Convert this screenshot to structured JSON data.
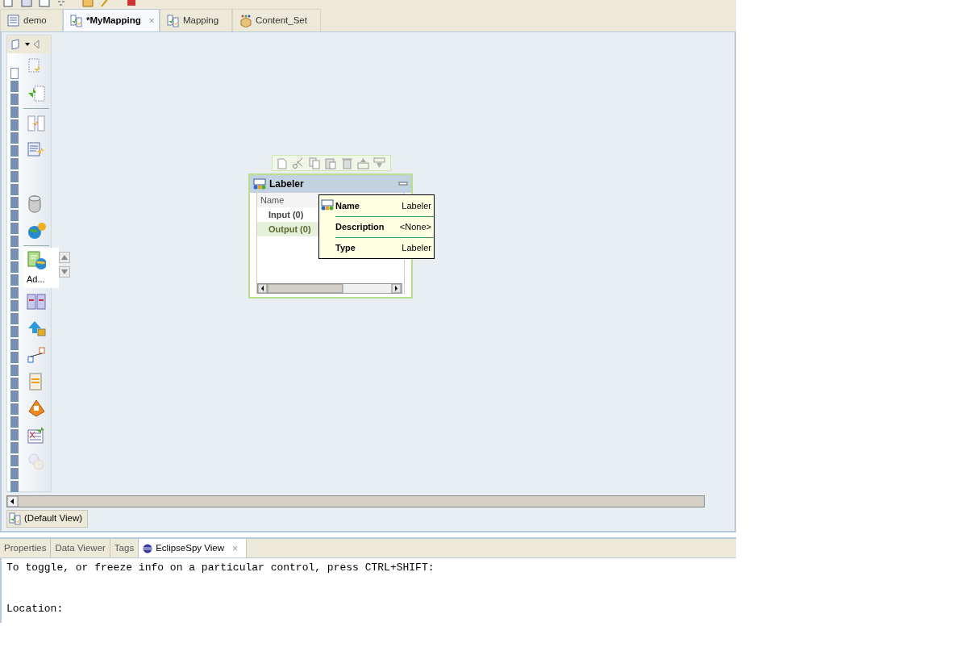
{
  "editor_tabs": [
    {
      "label": "demo",
      "kind": "table",
      "selected": false
    },
    {
      "label": "*MyMapping",
      "kind": "mapping",
      "selected": true,
      "close": "×"
    },
    {
      "label": "Mapping",
      "kind": "mapping",
      "selected": false
    },
    {
      "label": "Content_Set",
      "kind": "package",
      "selected": false
    }
  ],
  "palette": {
    "items": [
      {
        "kind": "tool",
        "selected": false
      },
      {
        "kind": "tool",
        "selected": false
      },
      {
        "kind": "separator"
      },
      {
        "kind": "tool",
        "selected": false
      },
      {
        "kind": "tool",
        "selected": false
      },
      {
        "kind": "gap"
      },
      {
        "kind": "tool",
        "selected": false
      },
      {
        "kind": "tool",
        "selected": false
      },
      {
        "kind": "separator"
      },
      {
        "kind": "tool",
        "selected": true,
        "label": "Ad..."
      },
      {
        "kind": "tool",
        "selected": false
      },
      {
        "kind": "tool",
        "selected": false
      },
      {
        "kind": "tool",
        "selected": false
      },
      {
        "kind": "tool",
        "selected": false
      },
      {
        "kind": "tool",
        "selected": false
      },
      {
        "kind": "tool",
        "selected": false
      },
      {
        "kind": "tool",
        "selected": false,
        "disabled": true
      }
    ]
  },
  "transformation": {
    "title": "Labeler",
    "column": "Name",
    "rows": [
      {
        "label": "Input (0)",
        "selected": false
      },
      {
        "label": "Output (0)",
        "selected": true
      }
    ]
  },
  "tooltip": {
    "rows": [
      {
        "key": "Name",
        "value": "Labeler"
      },
      {
        "key": "Description",
        "value": "<None>"
      },
      {
        "key": "Type",
        "value": "Labeler"
      }
    ]
  },
  "view_tab": {
    "label": "(Default View)"
  },
  "bottom_tabs": [
    {
      "label": "Properties",
      "selected": false
    },
    {
      "label": "Data Viewer",
      "selected": false
    },
    {
      "label": "Tags",
      "selected": false
    },
    {
      "label": "EclipseSpy View",
      "selected": true,
      "close": "×"
    }
  ],
  "console": {
    "prompt": "To toggle, or freeze info on a particular control, press CTRL+SHIFT:",
    "location": "Location:"
  }
}
